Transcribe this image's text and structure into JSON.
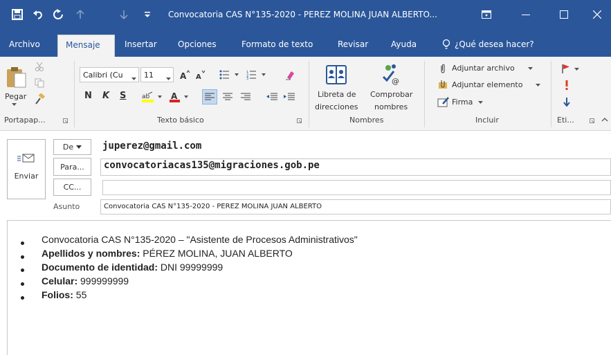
{
  "window": {
    "title": "Convocatoria CAS N°135-2020 - PEREZ MOLINA JUAN ALBERTO..."
  },
  "menu": {
    "tabs": [
      "Archivo",
      "Mensaje",
      "Insertar",
      "Opciones",
      "Formato de texto",
      "Revisar",
      "Ayuda"
    ],
    "tell_me": "¿Qué desea hacer?"
  },
  "ribbon": {
    "clipboard": {
      "paste": "Pegar",
      "group": "Portapap..."
    },
    "basic_text": {
      "font_name": "Calibri (Cu",
      "font_size": "11",
      "bold": "N",
      "italic": "K",
      "underline": "S",
      "group": "Texto básico"
    },
    "names": {
      "address_book": "Libreta de direcciones",
      "address_book_line1": "Libreta de",
      "address_book_line2": "direcciones",
      "check_names_line1": "Comprobar",
      "check_names_line2": "nombres",
      "group": "Nombres"
    },
    "include": {
      "attach_file": "Adjuntar archivo",
      "attach_item": "Adjuntar elemento",
      "signature": "Firma",
      "group": "Incluir"
    },
    "tags": {
      "group": "Eti..."
    }
  },
  "compose": {
    "send": "Enviar",
    "from_label": "De",
    "from_value": "juperez@gmail.com",
    "to_label": "Para...",
    "to_value": "convocatoriacas135@migraciones.gob.pe",
    "cc_label": "CC...",
    "cc_value": "",
    "subject_label": "Asunto",
    "subject_value": "Convocatoria CAS N°135-2020 - PEREZ MOLINA JUAN ALBERTO"
  },
  "body": {
    "line1": "Convocatoria CAS N°135-2020 – \"Asistente de Procesos Administrativos\"",
    "line2_label": "Apellidos y nombres:",
    "line2_value": " PÉREZ MOLINA, JUAN ALBERTO",
    "line3_label": "Documento de identidad:",
    "line3_value": " DNI 99999999",
    "line4_label": "Celular:",
    "line4_value": " 999999999",
    "line5_label": "Folios:",
    "line5_value": " 55"
  },
  "colors": {
    "accent": "#2b579a",
    "ribbon_bg": "#f3f3f3"
  }
}
